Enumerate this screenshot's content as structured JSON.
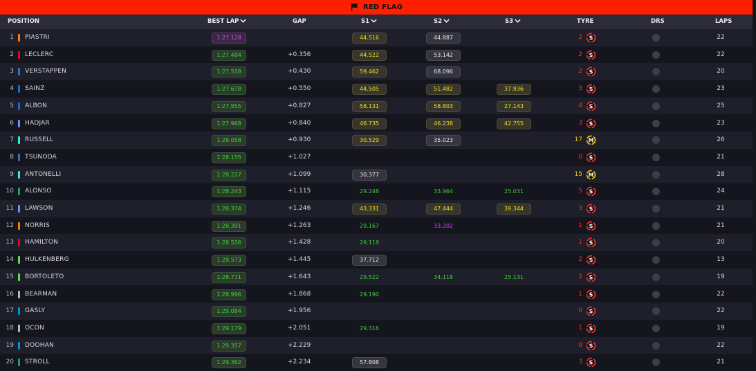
{
  "banner": {
    "label": "RED FLAG",
    "icon": "flag-icon",
    "color": "#ff1e00"
  },
  "columns": {
    "position": "POSITION",
    "best_lap": "BEST LAP",
    "gap": "GAP",
    "s1": "S1",
    "s2": "S2",
    "s3": "S3",
    "tyre": "TYRE",
    "drs": "DRS",
    "laps": "LAPS"
  },
  "colors": {
    "personal_best": "#3fd23a",
    "overall_best": "#d24bf0",
    "yellow": "#f2e21b",
    "soft_tyre": "#ff2a2a",
    "medium_tyre": "#f2c200"
  },
  "rows": [
    {
      "pos": "1",
      "name": "PIASTRI",
      "team_color": "#ff8000",
      "best_lap": "1:27.128",
      "lap_style": "purple",
      "gap": "",
      "s1": "44.516",
      "s1_style": "yellow",
      "s2": "44.887",
      "s2_style": "white",
      "s3": "",
      "s3_style": "",
      "tyre_age": "2",
      "tyre": "S",
      "drs": "off",
      "laps": "22"
    },
    {
      "pos": "2",
      "name": "LECLERC",
      "team_color": "#e8002d",
      "best_lap": "1:27.484",
      "lap_style": "green",
      "gap": "+0.356",
      "s1": "44.522",
      "s1_style": "yellow",
      "s2": "53.142",
      "s2_style": "white",
      "s3": "",
      "s3_style": "",
      "tyre_age": "2",
      "tyre": "S",
      "drs": "off",
      "laps": "22"
    },
    {
      "pos": "3",
      "name": "VERSTAPPEN",
      "team_color": "#3671c6",
      "best_lap": "1:27.558",
      "lap_style": "green",
      "gap": "+0.430",
      "s1": "59.462",
      "s1_style": "yellow",
      "s2": "68.096",
      "s2_style": "white",
      "s3": "",
      "s3_style": "",
      "tyre_age": "2",
      "tyre": "S",
      "drs": "off",
      "laps": "20"
    },
    {
      "pos": "4",
      "name": "SAINZ",
      "team_color": "#1868db",
      "best_lap": "1:27.678",
      "lap_style": "green",
      "gap": "+0.550",
      "s1": "44.505",
      "s1_style": "yellow",
      "s2": "51.482",
      "s2_style": "yellow",
      "s3": "37.936",
      "s3_style": "yellow",
      "tyre_age": "3",
      "tyre": "S",
      "drs": "off",
      "laps": "23"
    },
    {
      "pos": "5",
      "name": "ALBON",
      "team_color": "#1868db",
      "best_lap": "1:27.955",
      "lap_style": "green",
      "gap": "+0.827",
      "s1": "58.131",
      "s1_style": "yellow",
      "s2": "58.803",
      "s2_style": "yellow",
      "s3": "27.143",
      "s3_style": "yellow",
      "tyre_age": "4",
      "tyre": "S",
      "drs": "off",
      "laps": "25"
    },
    {
      "pos": "6",
      "name": "HADJAR",
      "team_color": "#6692ff",
      "best_lap": "1:27.968",
      "lap_style": "green",
      "gap": "+0.840",
      "s1": "46.735",
      "s1_style": "yellow",
      "s2": "46.238",
      "s2_style": "yellow",
      "s3": "42.755",
      "s3_style": "yellow",
      "tyre_age": "3",
      "tyre": "S",
      "drs": "off",
      "laps": "23"
    },
    {
      "pos": "7",
      "name": "RUSSELL",
      "team_color": "#27f4d2",
      "best_lap": "1:28.058",
      "lap_style": "green",
      "gap": "+0.930",
      "s1": "30.529",
      "s1_style": "yellow",
      "s2": "35.023",
      "s2_style": "white",
      "s3": "",
      "s3_style": "",
      "tyre_age": "17",
      "tyre": "M",
      "drs": "off",
      "laps": "26"
    },
    {
      "pos": "8",
      "name": "TSUNODA",
      "team_color": "#3671c6",
      "best_lap": "1:28.155",
      "lap_style": "green",
      "gap": "+1.027",
      "s1": "",
      "s1_style": "",
      "s2": "",
      "s2_style": "",
      "s3": "",
      "s3_style": "",
      "tyre_age": "0",
      "tyre": "S",
      "drs": "off",
      "laps": "21"
    },
    {
      "pos": "9",
      "name": "ANTONELLI",
      "team_color": "#27f4d2",
      "best_lap": "1:28.227",
      "lap_style": "green",
      "gap": "+1.099",
      "s1": "30.377",
      "s1_style": "white",
      "s2": "",
      "s2_style": "",
      "s3": "",
      "s3_style": "",
      "tyre_age": "15",
      "tyre": "M",
      "drs": "off",
      "laps": "28"
    },
    {
      "pos": "10",
      "name": "ALONSO",
      "team_color": "#229971",
      "best_lap": "1:28.243",
      "lap_style": "green",
      "gap": "+1.115",
      "s1": "29.248",
      "s1_style": "sgreen",
      "s2": "33.964",
      "s2_style": "sgreen",
      "s3": "25.031",
      "s3_style": "sgreen",
      "tyre_age": "5",
      "tyre": "S",
      "drs": "off",
      "laps": "24"
    },
    {
      "pos": "11",
      "name": "LAWSON",
      "team_color": "#6692ff",
      "best_lap": "1:28.374",
      "lap_style": "green",
      "gap": "+1.246",
      "s1": "43.331",
      "s1_style": "yellow",
      "s2": "47.444",
      "s2_style": "yellow",
      "s3": "39.344",
      "s3_style": "yellow",
      "tyre_age": "3",
      "tyre": "S",
      "drs": "off",
      "laps": "21"
    },
    {
      "pos": "12",
      "name": "NORRIS",
      "team_color": "#ff8000",
      "best_lap": "1:28.391",
      "lap_style": "green",
      "gap": "+1.263",
      "s1": "29.167",
      "s1_style": "sgreen",
      "s2": "33.202",
      "s2_style": "spurple",
      "s3": "",
      "s3_style": "",
      "tyre_age": "1",
      "tyre": "S",
      "drs": "off",
      "laps": "21"
    },
    {
      "pos": "13",
      "name": "HAMILTON",
      "team_color": "#e8002d",
      "best_lap": "1:28.556",
      "lap_style": "green",
      "gap": "+1.428",
      "s1": "29.119",
      "s1_style": "sgreen",
      "s2": "",
      "s2_style": "",
      "s3": "",
      "s3_style": "",
      "tyre_age": "1",
      "tyre": "S",
      "drs": "off",
      "laps": "20"
    },
    {
      "pos": "14",
      "name": "HULKENBERG",
      "team_color": "#52e252",
      "best_lap": "1:28.573",
      "lap_style": "green",
      "gap": "+1.445",
      "s1": "37.712",
      "s1_style": "white",
      "s2": "",
      "s2_style": "",
      "s3": "",
      "s3_style": "",
      "tyre_age": "2",
      "tyre": "S",
      "drs": "off",
      "laps": "13"
    },
    {
      "pos": "15",
      "name": "BORTOLETO",
      "team_color": "#52e252",
      "best_lap": "1:28.771",
      "lap_style": "green",
      "gap": "+1.643",
      "s1": "29.522",
      "s1_style": "sgreen",
      "s2": "34.118",
      "s2_style": "sgreen",
      "s3": "25.131",
      "s3_style": "sgreen",
      "tyre_age": "2",
      "tyre": "S",
      "drs": "off",
      "laps": "19"
    },
    {
      "pos": "16",
      "name": "BEARMAN",
      "team_color": "#b6babd",
      "best_lap": "1:28.996",
      "lap_style": "green",
      "gap": "+1.868",
      "s1": "29.190",
      "s1_style": "sgreen",
      "s2": "",
      "s2_style": "",
      "s3": "",
      "s3_style": "",
      "tyre_age": "1",
      "tyre": "S",
      "drs": "off",
      "laps": "22"
    },
    {
      "pos": "17",
      "name": "GASLY",
      "team_color": "#0093cc",
      "best_lap": "1:29.084",
      "lap_style": "green",
      "gap": "+1.956",
      "s1": "",
      "s1_style": "",
      "s2": "",
      "s2_style": "",
      "s3": "",
      "s3_style": "",
      "tyre_age": "0",
      "tyre": "S",
      "drs": "off",
      "laps": "22"
    },
    {
      "pos": "18",
      "name": "OCON",
      "team_color": "#b6babd",
      "best_lap": "1:29.179",
      "lap_style": "green",
      "gap": "+2.051",
      "s1": "29.316",
      "s1_style": "sgreen",
      "s2": "",
      "s2_style": "",
      "s3": "",
      "s3_style": "",
      "tyre_age": "1",
      "tyre": "S",
      "drs": "off",
      "laps": "19"
    },
    {
      "pos": "19",
      "name": "DOOHAN",
      "team_color": "#0093cc",
      "best_lap": "1:29.357",
      "lap_style": "green",
      "gap": "+2.229",
      "s1": "",
      "s1_style": "",
      "s2": "",
      "s2_style": "",
      "s3": "",
      "s3_style": "",
      "tyre_age": "0",
      "tyre": "S",
      "drs": "off",
      "laps": "22"
    },
    {
      "pos": "20",
      "name": "STROLL",
      "team_color": "#229971",
      "best_lap": "1:29.362",
      "lap_style": "green",
      "gap": "+2.234",
      "s1": "57.808",
      "s1_style": "white",
      "s2": "",
      "s2_style": "",
      "s3": "",
      "s3_style": "",
      "tyre_age": "3",
      "tyre": "S",
      "drs": "off",
      "laps": "21"
    }
  ]
}
